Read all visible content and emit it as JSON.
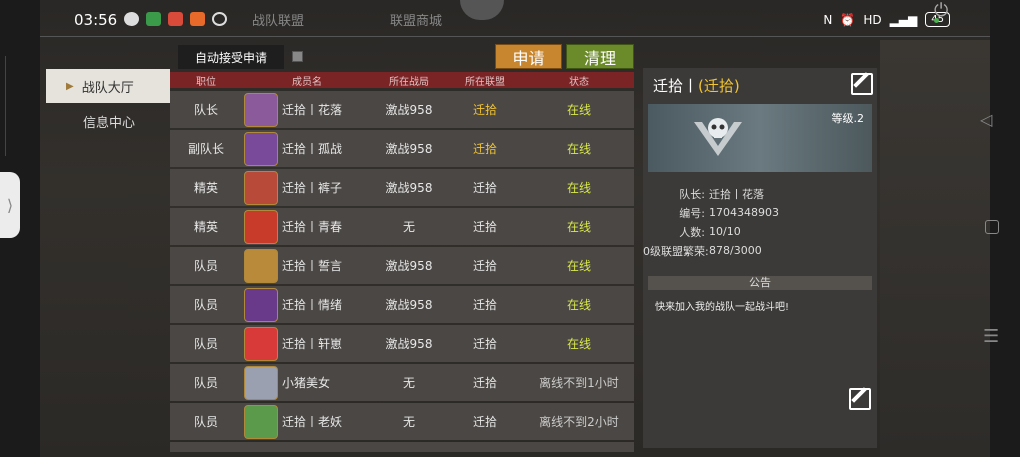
{
  "status_bar": {
    "time": "03:56",
    "battery": "45"
  },
  "top_tabs": [
    "战队联盟",
    "联盟商城"
  ],
  "nav": {
    "items": [
      {
        "label": "战队大厅",
        "active": true
      },
      {
        "label": "信息中心",
        "active": false
      }
    ]
  },
  "toolbar": {
    "auto_accept_label": "自动接受申请",
    "apply_label": "申请",
    "clear_label": "清理"
  },
  "table": {
    "headers": [
      "职位",
      "成员名",
      "所在战局",
      "所在联盟",
      "状态"
    ],
    "rows": [
      {
        "position": "队长",
        "name": "迁拾丨花落",
        "battle": "激战958",
        "alliance": "迁拾",
        "status": "在线",
        "alliance_gold": true,
        "avatar_color": "#8a5a9a"
      },
      {
        "position": "副队长",
        "name": "迁拾丨孤战",
        "battle": "激战958",
        "alliance": "迁拾",
        "status": "在线",
        "alliance_gold": true,
        "avatar_color": "#7a4a9a"
      },
      {
        "position": "精英",
        "name": "迁拾丨裤子",
        "battle": "激战958",
        "alliance": "迁拾",
        "status": "在线",
        "alliance_gold": false,
        "avatar_color": "#b84a3a"
      },
      {
        "position": "精英",
        "name": "迁拾丨青春",
        "battle": "无",
        "alliance": "迁拾",
        "status": "在线",
        "alliance_gold": false,
        "avatar_color": "#c83a2a"
      },
      {
        "position": "队员",
        "name": "迁拾丨誓言",
        "battle": "激战958",
        "alliance": "迁拾",
        "status": "在线",
        "alliance_gold": false,
        "avatar_color": "#b88a3a"
      },
      {
        "position": "队员",
        "name": "迁拾丨情绪",
        "battle": "激战958",
        "alliance": "迁拾",
        "status": "在线",
        "alliance_gold": false,
        "avatar_color": "#6a3a8a"
      },
      {
        "position": "队员",
        "name": "迁拾丨轩崽",
        "battle": "激战958",
        "alliance": "迁拾",
        "status": "在线",
        "alliance_gold": false,
        "avatar_color": "#d83a3a"
      },
      {
        "position": "队员",
        "name": "小猪美女",
        "battle": "无",
        "alliance": "迁拾",
        "status": "离线不到1小时",
        "alliance_gold": false,
        "avatar_color": "#9aa0b0"
      },
      {
        "position": "队员",
        "name": "迁拾丨老妖",
        "battle": "无",
        "alliance": "迁拾",
        "status": "离线不到2小时",
        "alliance_gold": false,
        "avatar_color": "#5a9a4a"
      }
    ]
  },
  "team": {
    "title_prefix": "迁拾丨",
    "title_gold": "(迁拾)",
    "level": "等级.2",
    "captain_label": "队长:",
    "captain": "迁拾丨花落",
    "id_label": "编号:",
    "id": "1704348903",
    "count_label": "人数:",
    "count": "10/10",
    "prosperity_label": "0级联盟繁荣:",
    "prosperity": "878/3000",
    "notice_label": "公告",
    "notice_text": "快来加入我的战队一起战斗吧!"
  }
}
